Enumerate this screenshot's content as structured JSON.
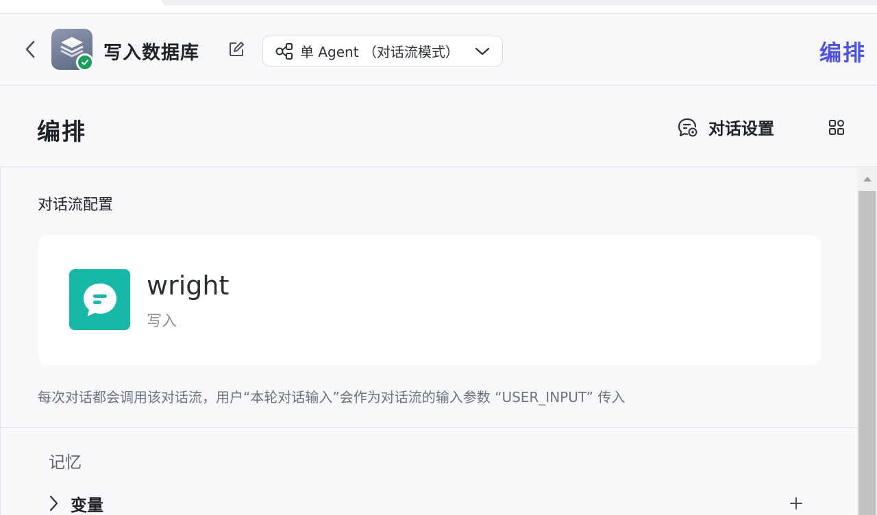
{
  "header": {
    "app_title": "写入数据库",
    "mode_label": "单 Agent （对话流模式）",
    "page_title": "编排"
  },
  "subheader": {
    "section_title": "编排",
    "chat_settings_label": "对话设置"
  },
  "flow_config": {
    "label": "对话流配置",
    "flow": {
      "name": "wright",
      "description": "写入",
      "icon": "chat-bubble-icon",
      "icon_color": "#18b8a9"
    },
    "hint": "每次对话都会调用该对话流，用户“本轮对话输入”会作为对话流的输入参数 “USER_INPUT” 传入"
  },
  "memory": {
    "label": "记忆",
    "variables_label": "变量"
  },
  "colors": {
    "accent": "#4d53e8",
    "status_ok": "#18a058"
  }
}
